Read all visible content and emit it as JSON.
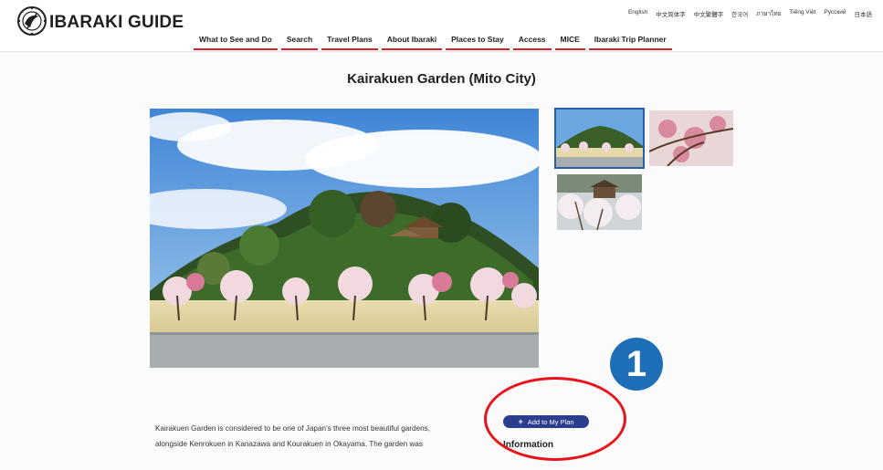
{
  "header": {
    "logo_text": "IBARAKI GUIDE",
    "languages": [
      "English",
      "中文简体字",
      "中文繁體字",
      "한국어",
      "ภาษาไทย",
      "Tiếng Việt",
      "Русский",
      "日本語"
    ],
    "nav": [
      "What to See and Do",
      "Search",
      "Travel Plans",
      "About Ibaraki",
      "Places to Stay",
      "Access",
      "MICE",
      "Ibaraki Trip Planner"
    ]
  },
  "page": {
    "title": "Kairakuen Garden (Mito City)"
  },
  "description": {
    "line1": "Kairakuen Garden is considered to be one of  Japan's three most beautiful gardens,",
    "line2": "alongside Kenrokuen in Kanazawa and Kourakuen in Okayama. The garden was"
  },
  "actions": {
    "add_plan_icon": "+",
    "add_plan_label": "Add to My Plan"
  },
  "info": {
    "heading": "Information"
  },
  "annotation": {
    "badge": "1"
  },
  "colors": {
    "nav_underline": "#d4252c",
    "button_bg": "#2b3d8f",
    "annotation_red": "#e8141c",
    "badge_blue": "#1e6fb8",
    "thumb_selected": "#2a5fa8"
  },
  "icons": {
    "logo": "ibaraki-emblem-icon",
    "add": "plus-icon"
  }
}
